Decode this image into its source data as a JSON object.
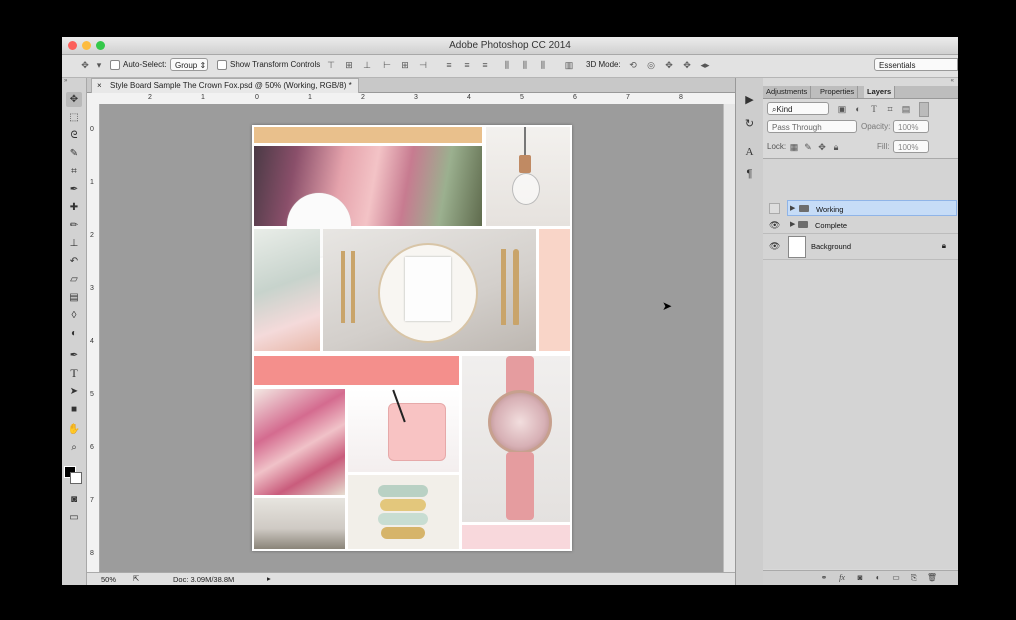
{
  "app": {
    "title": "Adobe Photoshop CC 2014",
    "traffic_light_colors": {
      "close": "#fc605b",
      "minimize": "#fdbc40",
      "zoom": "#34c84a"
    }
  },
  "options_bar": {
    "auto_select_label": "Auto-Select:",
    "auto_select_value": "Group",
    "transform_controls_label": "Show Transform Controls",
    "mode_3d_label": "3D Mode:",
    "workspace": "Essentials"
  },
  "document": {
    "tab_title": "Style Board Sample The Crown Fox.psd @ 50% (Working, RGB/8) *",
    "close_glyph": "×"
  },
  "rulers": {
    "h_labels": [
      "2",
      "1",
      "0",
      "1",
      "2",
      "3",
      "4",
      "5",
      "6",
      "7",
      "8"
    ],
    "v_labels": [
      "0",
      "1",
      "2",
      "3",
      "4",
      "5",
      "6",
      "7",
      "8"
    ]
  },
  "status": {
    "zoom": "50%",
    "doc_info": "Doc: 3.09M/38.8M"
  },
  "panel": {
    "tabs": [
      "Adjustments",
      "Properties",
      "Layers"
    ],
    "active_tab": "Layers",
    "filter_kind": "Kind",
    "blend_mode": "Pass Through",
    "opacity_label": "Opacity:",
    "opacity_value": "100%",
    "lock_label": "Lock:",
    "fill_label": "Fill:",
    "fill_value": "100%",
    "layers": [
      {
        "name": "Working",
        "type": "group",
        "visible": false,
        "selected": true
      },
      {
        "name": "Complete",
        "type": "group",
        "visible": true,
        "selected": false
      },
      {
        "name": "Background",
        "type": "pixel",
        "visible": true,
        "locked": true,
        "selected": false
      }
    ]
  },
  "colors": {
    "selection_highlight": "#c6dcf7",
    "canvas_gray": "#9c9c9c",
    "accent_peach": "#e9c08c",
    "accent_coral": "#f48f8c",
    "accent_blush": "#f9d5c8"
  }
}
